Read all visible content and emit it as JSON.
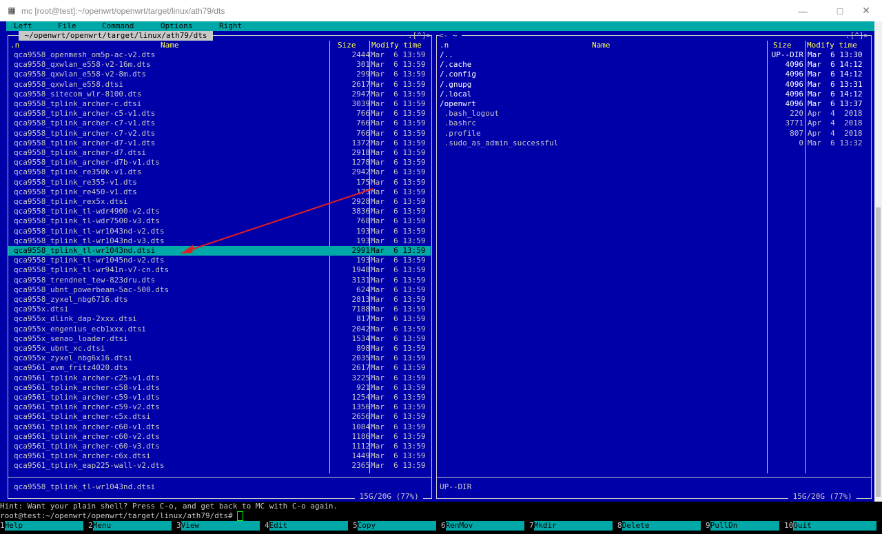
{
  "window": {
    "title": "mc [root@test]:~/openwrt/openwrt/target/linux/ath79/dts"
  },
  "menu": [
    "Left",
    "File",
    "Command",
    "Options",
    "Right"
  ],
  "left": {
    "path": " ~/openwrt/openwrt/target/linux/ath79/dts ",
    "corner": ".[^]>",
    "sort": ".n",
    "col_name": "Name",
    "col_size": "Size",
    "col_time": "Modify time",
    "rows": [
      [
        "qca9558_openmesh_om5p-ac-v2.dts",
        "2444",
        "Mar  6 13:59"
      ],
      [
        "qca9558_qxwlan_e558-v2-16m.dts",
        "301",
        "Mar  6 13:59"
      ],
      [
        "qca9558_qxwlan_e558-v2-8m.dts",
        "299",
        "Mar  6 13:59"
      ],
      [
        "qca9558_qxwlan_e558.dtsi",
        "2617",
        "Mar  6 13:59"
      ],
      [
        "qca9558_sitecom_wlr-8100.dts",
        "2947",
        "Mar  6 13:59"
      ],
      [
        "qca9558_tplink_archer-c.dtsi",
        "3039",
        "Mar  6 13:59"
      ],
      [
        "qca9558_tplink_archer-c5-v1.dts",
        "766",
        "Mar  6 13:59"
      ],
      [
        "qca9558_tplink_archer-c7-v1.dts",
        "766",
        "Mar  6 13:59"
      ],
      [
        "qca9558_tplink_archer-c7-v2.dts",
        "766",
        "Mar  6 13:59"
      ],
      [
        "qca9558_tplink_archer-d7-v1.dts",
        "1372",
        "Mar  6 13:59"
      ],
      [
        "qca9558_tplink_archer-d7.dtsi",
        "2918",
        "Mar  6 13:59"
      ],
      [
        "qca9558_tplink_archer-d7b-v1.dts",
        "1278",
        "Mar  6 13:59"
      ],
      [
        "qca9558_tplink_re350k-v1.dts",
        "2942",
        "Mar  6 13:59"
      ],
      [
        "qca9558_tplink_re355-v1.dts",
        "175",
        "Mar  6 13:59"
      ],
      [
        "qca9558_tplink_re450-v1.dts",
        "175",
        "Mar  6 13:59"
      ],
      [
        "qca9558_tplink_rex5x.dtsi",
        "2928",
        "Mar  6 13:59"
      ],
      [
        "qca9558_tplink_tl-wdr4900-v2.dts",
        "3836",
        "Mar  6 13:59"
      ],
      [
        "qca9558_tplink_tl-wdr7500-v3.dts",
        "768",
        "Mar  6 13:59"
      ],
      [
        "qca9558_tplink_tl-wr1043nd-v2.dts",
        "193",
        "Mar  6 13:59"
      ],
      [
        "qca9558_tplink_tl-wr1043nd-v3.dts",
        "193",
        "Mar  6 13:59"
      ],
      [
        "qca9558_tplink_tl-wr1043nd.dtsi",
        "2991",
        "Mar  6 13:59"
      ],
      [
        "qca9558_tplink_tl-wr1045nd-v2.dts",
        "193",
        "Mar  6 13:59"
      ],
      [
        "qca9558_tplink_tl-wr941n-v7-cn.dts",
        "1948",
        "Mar  6 13:59"
      ],
      [
        "qca9558_trendnet_tew-823dru.dts",
        "3131",
        "Mar  6 13:59"
      ],
      [
        "qca9558_ubnt_powerbeam-5ac-500.dts",
        "624",
        "Mar  6 13:59"
      ],
      [
        "qca9558_zyxel_nbg6716.dts",
        "2813",
        "Mar  6 13:59"
      ],
      [
        "qca955x.dtsi",
        "7188",
        "Mar  6 13:59"
      ],
      [
        "qca955x_dlink_dap-2xxx.dtsi",
        "817",
        "Mar  6 13:59"
      ],
      [
        "qca955x_engenius_ecb1xxx.dtsi",
        "2042",
        "Mar  6 13:59"
      ],
      [
        "qca955x_senao_loader.dtsi",
        "1534",
        "Mar  6 13:59"
      ],
      [
        "qca955x_ubnt_xc.dtsi",
        "898",
        "Mar  6 13:59"
      ],
      [
        "qca955x_zyxel_nbg6x16.dtsi",
        "2035",
        "Mar  6 13:59"
      ],
      [
        "qca9561_avm_fritz4020.dts",
        "2617",
        "Mar  6 13:59"
      ],
      [
        "qca9561_tplink_archer-c25-v1.dts",
        "3225",
        "Mar  6 13:59"
      ],
      [
        "qca9561_tplink_archer-c58-v1.dts",
        "921",
        "Mar  6 13:59"
      ],
      [
        "qca9561_tplink_archer-c59-v1.dts",
        "1254",
        "Mar  6 13:59"
      ],
      [
        "qca9561_tplink_archer-c59-v2.dts",
        "1356",
        "Mar  6 13:59"
      ],
      [
        "qca9561_tplink_archer-c5x.dtsi",
        "2656",
        "Mar  6 13:59"
      ],
      [
        "qca9561_tplink_archer-c60-v1.dts",
        "1084",
        "Mar  6 13:59"
      ],
      [
        "qca9561_tplink_archer-c60-v2.dts",
        "1186",
        "Mar  6 13:59"
      ],
      [
        "qca9561_tplink_archer-c60-v3.dts",
        "1112",
        "Mar  6 13:59"
      ],
      [
        "qca9561_tplink_archer-c6x.dtsi",
        "1449",
        "Mar  6 13:59"
      ],
      [
        "qca9561_tplink_eap225-wall-v2.dts",
        "2365",
        "Mar  6 13:59"
      ]
    ],
    "selected_index": 20,
    "status": "qca9558_tplink_tl-wr1043nd.dtsi",
    "disk": " 15G/20G (77%) "
  },
  "right": {
    "path": "<- ~ ",
    "corner": ".[^]>",
    "sort": ".n",
    "col_name": "Name",
    "col_size": "Size",
    "col_time": "Modify time",
    "rows": [
      [
        "/..",
        "UP--DIR",
        "Mar  6 13:30",
        "dir"
      ],
      [
        "/.cache",
        "4096",
        "Mar  6 14:12",
        "dir"
      ],
      [
        "/.config",
        "4096",
        "Mar  6 14:12",
        "dir"
      ],
      [
        "/.gnupg",
        "4096",
        "Mar  6 13:31",
        "dir"
      ],
      [
        "/.local",
        "4096",
        "Mar  6 14:12",
        "dir"
      ],
      [
        "/openwrt",
        "4096",
        "Mar  6 13:37",
        "dir"
      ],
      [
        " .bash_logout",
        "220",
        "Apr  4  2018",
        "file"
      ],
      [
        " .bashrc",
        "3771",
        "Apr  4  2018",
        "file"
      ],
      [
        " .profile",
        "807",
        "Apr  4  2018",
        "file"
      ],
      [
        " .sudo_as_admin_successful",
        "0",
        "Mar  6 13:32",
        "file"
      ]
    ],
    "status": "UP--DIR",
    "disk": " 15G/20G (77%) "
  },
  "hint": "Hint: Want your plain shell? Press C-o, and get back to MC with C-o again.",
  "prompt": "root@test:~/openwrt/openwrt/target/linux/ath79/dts# ",
  "keys": [
    [
      "1",
      "Help"
    ],
    [
      "2",
      "Menu"
    ],
    [
      "3",
      "View"
    ],
    [
      "4",
      "Edit"
    ],
    [
      "5",
      "Copy"
    ],
    [
      "6",
      "RenMov"
    ],
    [
      "7",
      "Mkdir"
    ],
    [
      "8",
      "Delete"
    ],
    [
      "9",
      "PullDn"
    ],
    [
      "10",
      "Quit"
    ]
  ],
  "colors": {
    "panel_bg": "#0000a8",
    "accent": "#00a8a8",
    "header": "#ffff54",
    "annotation": "#e02020"
  }
}
